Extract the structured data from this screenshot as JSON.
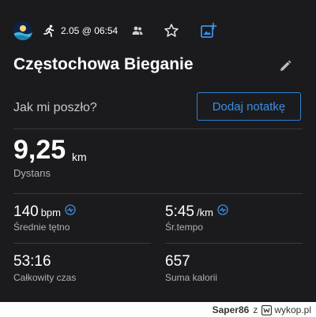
{
  "header": {
    "datetime": "2.05 @ 06:54",
    "icons": [
      "avatar",
      "running-icon",
      "people-icon",
      "star-icon",
      "add-photo-icon"
    ]
  },
  "activity": {
    "title": "Częstochowa Bieganie"
  },
  "note": {
    "prompt": "Jak mi poszło?",
    "button_label": "Dodaj notatkę"
  },
  "distance": {
    "value": "9,25",
    "unit": "km",
    "label": "Dystans"
  },
  "stats": [
    {
      "value": "140",
      "unit": "bpm",
      "label": "Średnie tętno"
    },
    {
      "value": "5:45",
      "unit": "/km",
      "label": "Śr.tempo"
    },
    {
      "value": "53:16",
      "unit": "",
      "label": "Całkowity czas"
    },
    {
      "value": "657",
      "unit": "",
      "label": "Suma kalorii"
    }
  ],
  "watermark": {
    "user": "Saper86",
    "joiner": "z",
    "site": "wykop.pl"
  },
  "colors": {
    "background": "#1b1b1d",
    "accent": "#3a8ee6",
    "label": "#b0b0b0"
  }
}
